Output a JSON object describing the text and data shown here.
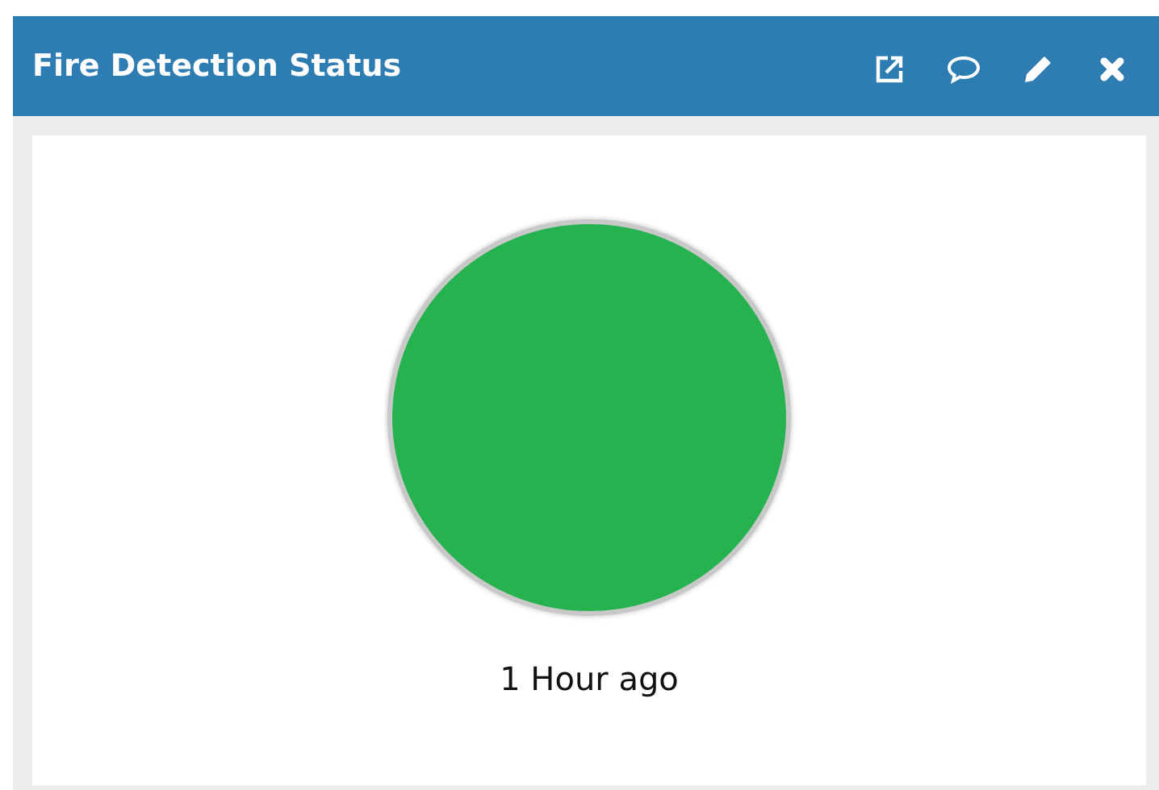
{
  "panel": {
    "title": "Fire Detection Status"
  },
  "status": {
    "color": "#26b24f",
    "time": "1 Hour ago"
  }
}
